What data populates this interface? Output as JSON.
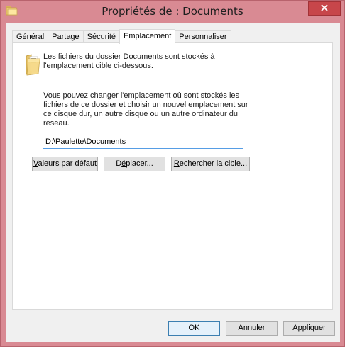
{
  "window": {
    "title": "Propriétés de : Documents",
    "close_symbol": "✕",
    "accent_color": "#d98a93"
  },
  "tabs": [
    {
      "label": "Général"
    },
    {
      "label": "Partage"
    },
    {
      "label": "Sécurité"
    },
    {
      "label": "Emplacement",
      "active": true
    },
    {
      "label": "Personnaliser"
    }
  ],
  "panel": {
    "info_line1": "Les fichiers du dossier Documents sont stockés à",
    "info_line2": "l'emplacement cible ci-dessous.",
    "desc_line1": "Vous pouvez changer l'emplacement où sont stockés les",
    "desc_line2": "fichiers de ce dossier et choisir un nouvel emplacement sur",
    "desc_line3": "ce disque dur, un autre disque ou un autre ordinateur du",
    "desc_line4": "réseau.",
    "path_value": "D:\\Paulette\\Documents",
    "restore_button": {
      "mnemonic": "V",
      "rest": "aleurs par défaut"
    },
    "move_button": {
      "pre": "D",
      "mnemonic": "é",
      "rest": "placer..."
    },
    "find_target_button": {
      "mnemonic": "R",
      "rest": "echercher la cible..."
    }
  },
  "footer": {
    "ok_label": "OK",
    "cancel_label": "Annuler",
    "apply_mnemonic": "A",
    "apply_rest": "ppliquer"
  },
  "icons": {
    "title_icon": "folder-properties-icon",
    "folder_icon": "documents-folder-icon",
    "close_icon": "close-icon"
  }
}
